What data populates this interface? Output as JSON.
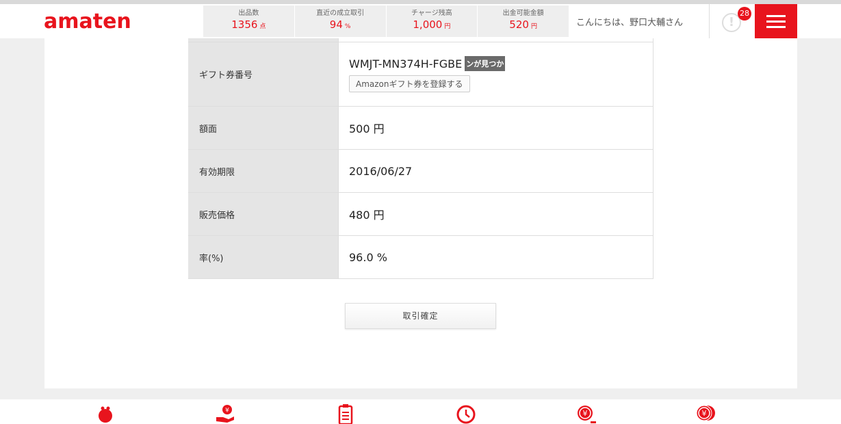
{
  "header": {
    "logo": "amaten",
    "stats": [
      {
        "label": "出品数",
        "value": "1356",
        "unit": "点"
      },
      {
        "label": "直近の成立取引",
        "value": "94",
        "unit": "%"
      },
      {
        "label": "チャージ残高",
        "value": "1,000",
        "unit": "円"
      },
      {
        "label": "出金可能金額",
        "value": "520",
        "unit": "円"
      }
    ],
    "greeting": "こんにちは、野口大輔さん",
    "alert_count": "28"
  },
  "detail": {
    "rows": [
      {
        "label": "ギフト券番号",
        "code": "WMJT-MN374H-FGBE",
        "code_tag": "ンが見つか",
        "register_label": "Amazonギフト券を登録する"
      },
      {
        "label": "額面",
        "value": "500 円"
      },
      {
        "label": "有効期限",
        "value": "2016/06/27"
      },
      {
        "label": "販売価格",
        "value": "480 円"
      },
      {
        "label": "率(%)",
        "value": "96.0 %"
      }
    ],
    "confirm_label": "取引確定"
  },
  "footer": {
    "icons": [
      "coin-purse-icon",
      "hand-yen-icon",
      "clipboard-icon",
      "clock-icon",
      "yen-search-icon",
      "yen-coins-icon"
    ]
  },
  "colors": {
    "accent": "#e8141d"
  }
}
